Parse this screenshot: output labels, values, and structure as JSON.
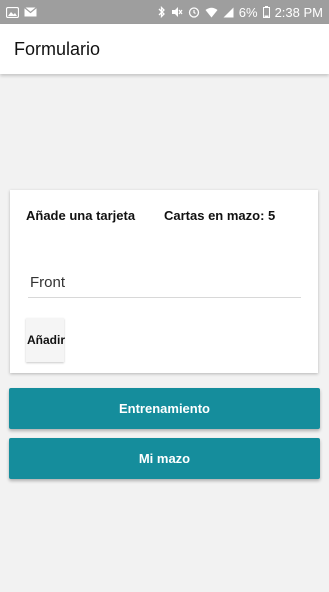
{
  "status_bar": {
    "left_icons": [
      "gallery-icon",
      "mail-icon"
    ],
    "right_icons": [
      "bluetooth-icon",
      "mute-icon",
      "alarm-icon",
      "wifi-icon",
      "signal-icon",
      "battery-icon"
    ],
    "battery_percent": "6%",
    "time": "2:38 PM"
  },
  "app_bar": {
    "title": "Formulario"
  },
  "card": {
    "add_card_label": "Añade una tarjeta",
    "deck_count_label": "Cartas en mazo: 5",
    "front_placeholder": "Front",
    "add_button_label": "Añadir"
  },
  "buttons": {
    "training_label": "Entrenamiento",
    "my_deck_label": "Mi mazo"
  },
  "colors": {
    "accent": "#158d9c",
    "status_bar": "#9e9e9e",
    "background": "#f2f2f2"
  }
}
